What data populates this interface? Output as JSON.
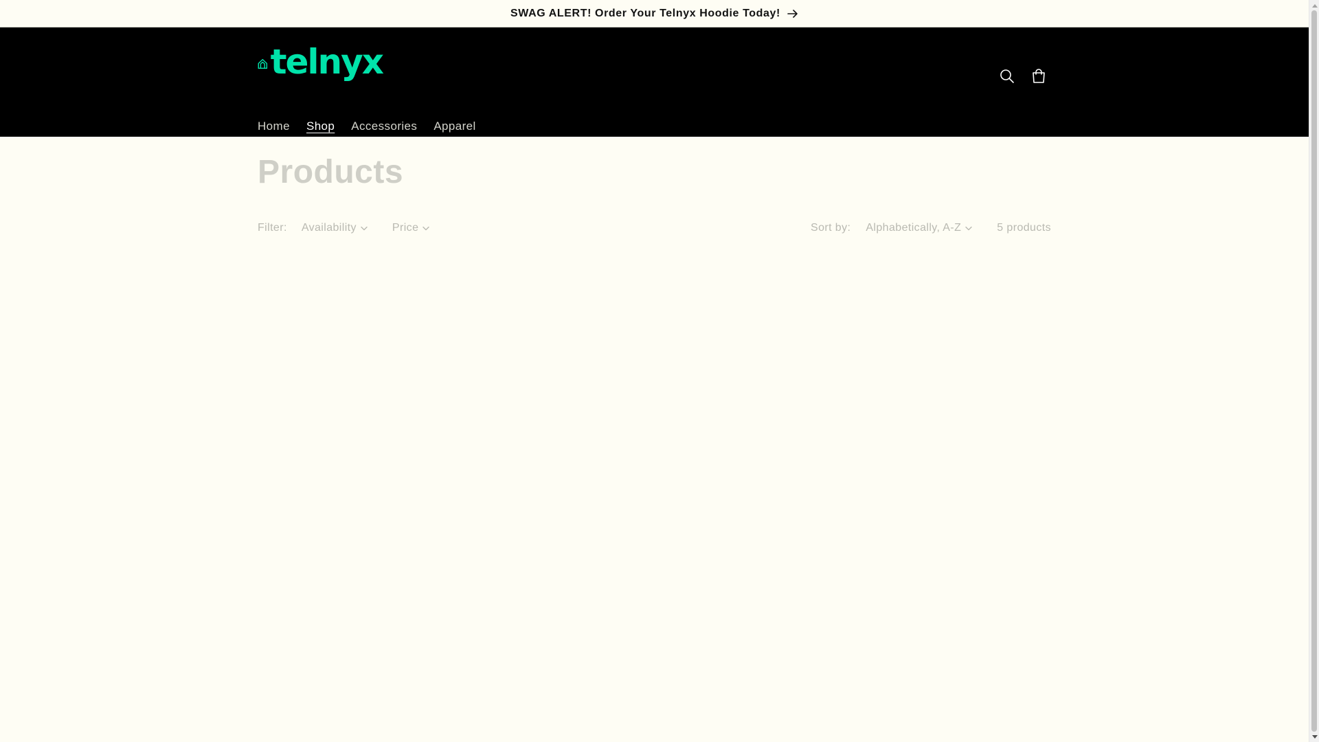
{
  "announcement": {
    "text": "SWAG ALERT! Order Your Telnyx Hoodie Today!"
  },
  "header": {
    "logo_text": "telnyx",
    "brand_color": "#00e3aa",
    "icons": [
      "search-icon",
      "cart-icon"
    ]
  },
  "nav": {
    "items": [
      {
        "label": "Home"
      },
      {
        "label": "Shop"
      },
      {
        "label": "Accessories"
      },
      {
        "label": "Apparel"
      }
    ],
    "active": "Shop"
  },
  "main": {
    "title": "Products",
    "filter_label": "Filter:",
    "filters": [
      {
        "label": "Availability"
      },
      {
        "label": "Price"
      }
    ],
    "sort_label": "Sort by:",
    "sort_value": "Alphabetically, A-Z",
    "product_count": "5 products"
  }
}
